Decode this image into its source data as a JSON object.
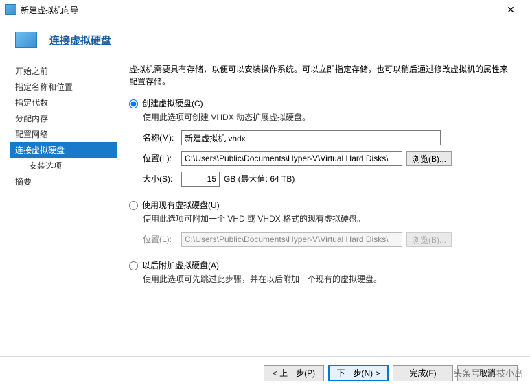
{
  "window": {
    "title": "新建虚拟机向导"
  },
  "header": {
    "title": "连接虚拟硬盘"
  },
  "sidebar": {
    "items": [
      {
        "label": "开始之前"
      },
      {
        "label": "指定名称和位置"
      },
      {
        "label": "指定代数"
      },
      {
        "label": "分配内存"
      },
      {
        "label": "配置网络"
      },
      {
        "label": "连接虚拟硬盘"
      },
      {
        "label": "安装选项"
      },
      {
        "label": "摘要"
      }
    ]
  },
  "content": {
    "intro": "虚拟机需要具有存储，以便可以安装操作系统。可以立即指定存储，也可以稍后通过修改虚拟机的属性来配置存储。",
    "option_create": {
      "label": "创建虚拟硬盘(C)",
      "desc": "使用此选项可创建 VHDX 动态扩展虚拟硬盘。",
      "name_label": "名称(M):",
      "name_value": "新建虚拟机.vhdx",
      "loc_label": "位置(L):",
      "loc_value": "C:\\Users\\Public\\Documents\\Hyper-V\\Virtual Hard Disks\\",
      "browse": "浏览(B)...",
      "size_label": "大小(S):",
      "size_value": "15",
      "size_unit": "GB (最大值: 64 TB)"
    },
    "option_existing": {
      "label": "使用现有虚拟硬盘(U)",
      "desc": "使用此选项可附加一个 VHD 或 VHDX 格式的现有虚拟硬盘。",
      "loc_label": "位置(L):",
      "loc_value": "C:\\Users\\Public\\Documents\\Hyper-V\\Virtual Hard Disks\\",
      "browse": "浏览(B)..."
    },
    "option_later": {
      "label": "以后附加虚拟硬盘(A)",
      "desc": "使用此选项可先跳过此步骤，并在以后附加一个现有的虚拟硬盘。"
    }
  },
  "footer": {
    "prev": "< 上一步(P)",
    "next": "下一步(N) >",
    "finish": "完成(F)",
    "cancel": "取消"
  },
  "watermark": "头条号 / 科技小岛"
}
